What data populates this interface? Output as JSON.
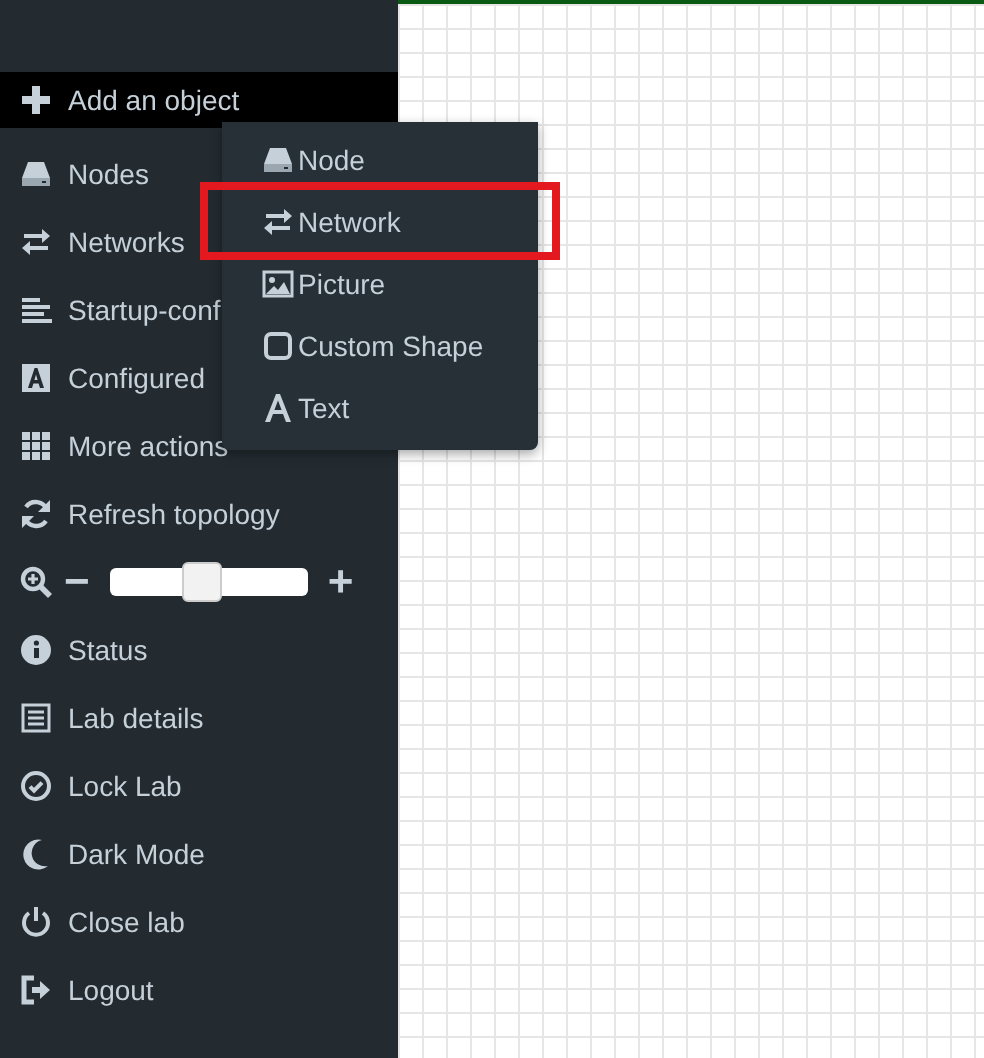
{
  "sidebar": {
    "items": [
      {
        "kind": "link",
        "label": "Add an object",
        "selected": true
      },
      {
        "kind": "link",
        "label": "Nodes",
        "selected": false
      },
      {
        "kind": "link",
        "label": "Networks",
        "selected": false
      },
      {
        "kind": "link",
        "label": "Startup-conf",
        "selected": false
      },
      {
        "kind": "link",
        "label": "Configured",
        "selected": false
      },
      {
        "kind": "link",
        "label": "More actions",
        "selected": false
      },
      {
        "kind": "link",
        "label": "Refresh topology",
        "selected": false
      },
      {
        "kind": "zoom",
        "minus": "−",
        "plus": "+",
        "level": 0.47
      },
      {
        "kind": "link",
        "label": "Status",
        "selected": false
      },
      {
        "kind": "link",
        "label": "Lab details",
        "selected": false
      },
      {
        "kind": "link",
        "label": "Lock Lab",
        "selected": false
      },
      {
        "kind": "link",
        "label": "Dark Mode",
        "selected": false
      },
      {
        "kind": "link",
        "label": "Close lab",
        "selected": false
      },
      {
        "kind": "link",
        "label": "Logout",
        "selected": false
      }
    ]
  },
  "add_menu": {
    "items": [
      {
        "label": "Node",
        "highlighted": false
      },
      {
        "label": "Network",
        "highlighted": true
      },
      {
        "label": "Picture",
        "highlighted": false
      },
      {
        "label": "Custom Shape",
        "highlighted": false
      },
      {
        "label": "Text",
        "highlighted": false
      }
    ]
  }
}
